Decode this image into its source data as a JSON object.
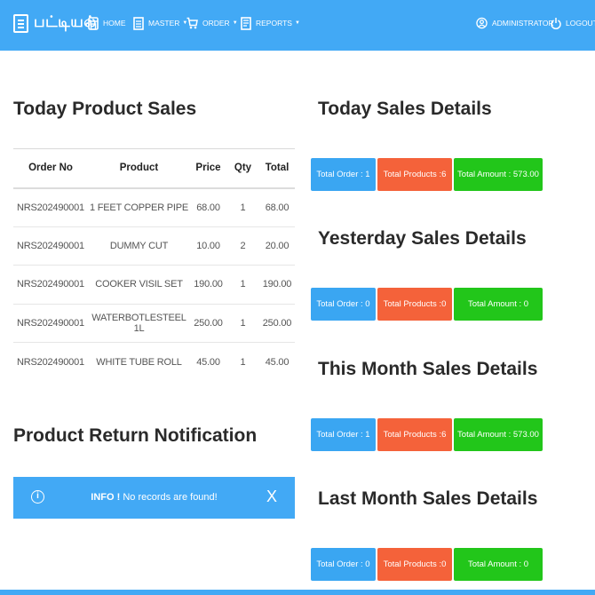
{
  "header": {
    "brand": "பட்டியல்",
    "nav": {
      "home": "HOME",
      "master": "MASTER",
      "order": "ORDER",
      "reports": "REPORTS",
      "admin": "ADMINISTRATOR",
      "logout": "LOGOUT"
    }
  },
  "today_product_sales": {
    "title": "Today Product Sales",
    "columns": [
      "Order No",
      "Product",
      "Price",
      "Qty",
      "Total"
    ],
    "rows": [
      [
        "NRS202490001",
        "1 FEET COPPER PIPE",
        "68.00",
        "1",
        "68.00"
      ],
      [
        "NRS202490001",
        "DUMMY CUT",
        "10.00",
        "2",
        "20.00"
      ],
      [
        "NRS202490001",
        "COOKER VISIL SET",
        "190.00",
        "1",
        "190.00"
      ],
      [
        "NRS202490001",
        "WATERBOTLESTEEL 1L",
        "250.00",
        "1",
        "250.00"
      ],
      [
        "NRS202490001",
        "WHITE TUBE ROLL",
        "45.00",
        "1",
        "45.00"
      ]
    ]
  },
  "product_return": {
    "title": "Product Return Notification",
    "info_label": "INFO !",
    "info_message": "No records are found!",
    "close": "X"
  },
  "sales_details": {
    "today": {
      "title": "Today Sales Details",
      "orders": "Total Order : 1",
      "products": "Total Products :6",
      "amount": "Total Amount : 573.00"
    },
    "yesterday": {
      "title": "Yesterday Sales Details",
      "orders": "Total Order : 0",
      "products": "Total Products :0",
      "amount": "Total Amount : 0"
    },
    "this_month": {
      "title": "This Month Sales Details",
      "orders": "Total Order : 1",
      "products": "Total Products :6",
      "amount": "Total Amount : 573.00"
    },
    "last_month": {
      "title": "Last Month Sales Details",
      "orders": "Total Order : 0",
      "products": "Total Products :0",
      "amount": "Total Amount : 0"
    }
  },
  "colors": {
    "header_blue": "#42a9f5",
    "badge_blue": "#3aa6f2",
    "badge_orange": "#f4623a",
    "badge_green": "#22c61a"
  },
  "icons": {
    "brand": "document-icon",
    "home": "store-icon",
    "master": "list-icon",
    "order": "cart-icon",
    "reports": "report-icon",
    "admin": "user-icon",
    "logout": "power-icon",
    "info": "info-icon",
    "close": "close-icon"
  }
}
